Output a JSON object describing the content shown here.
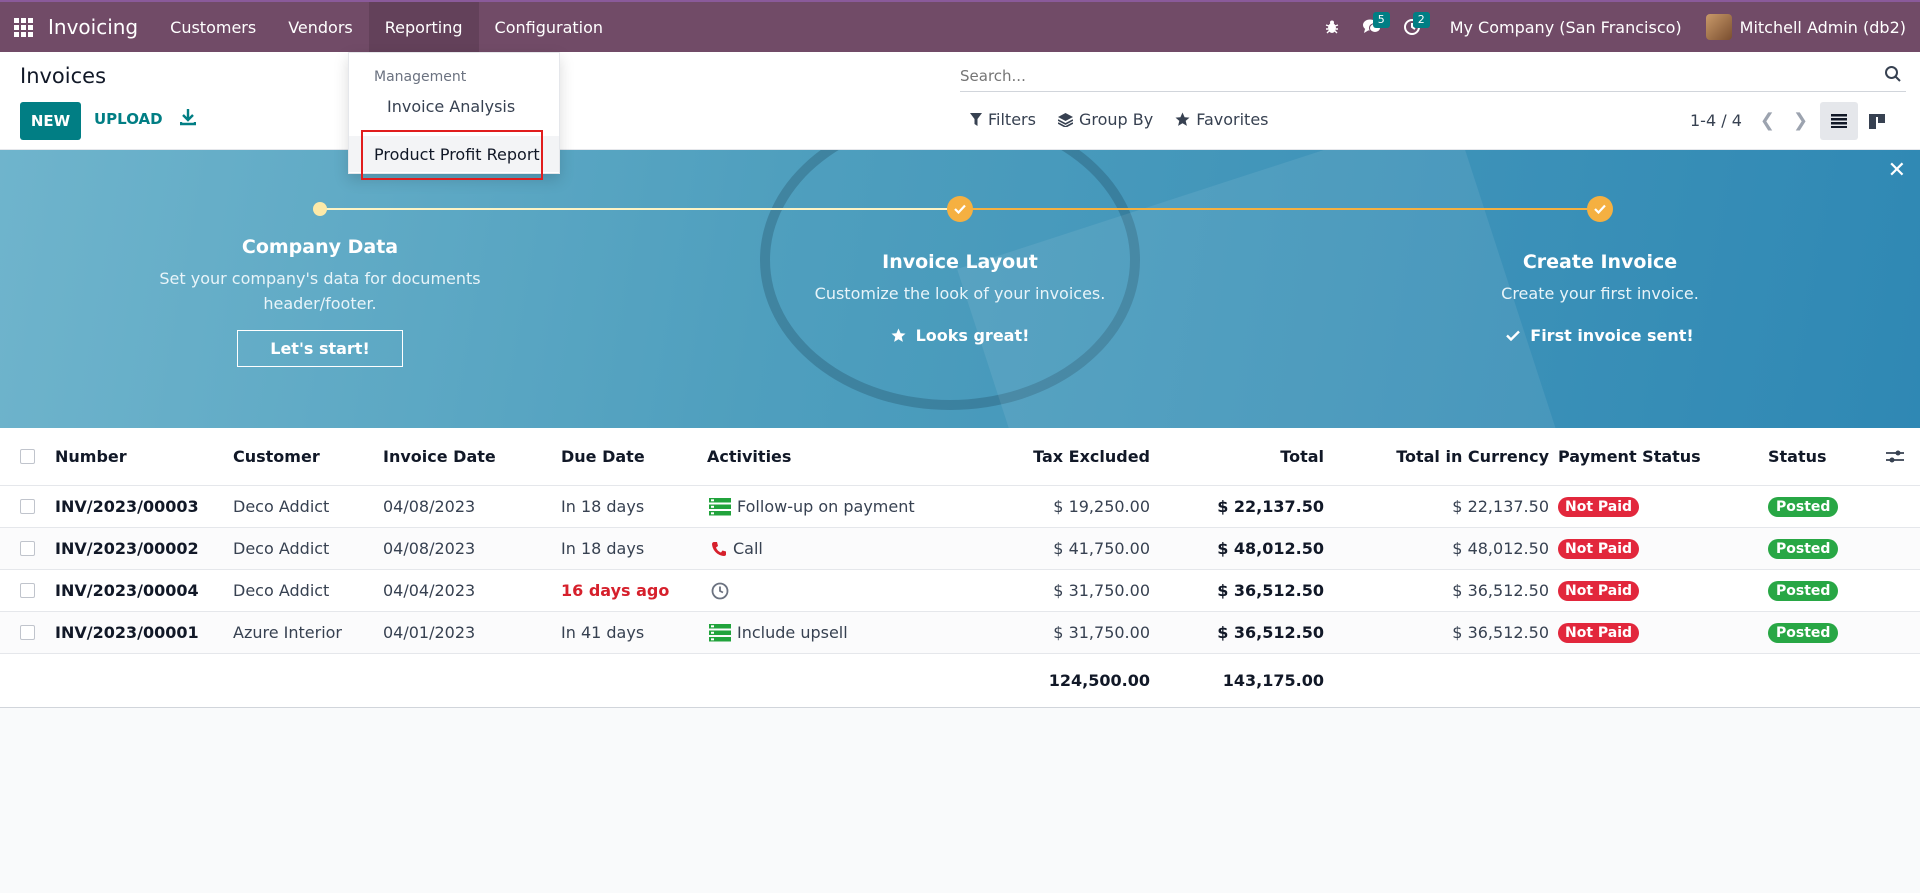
{
  "navbar": {
    "app_name": "Invoicing",
    "menu": [
      "Customers",
      "Vendors",
      "Reporting",
      "Configuration"
    ],
    "messages_count": "5",
    "activities_count": "2",
    "company": "My Company (San Francisco)",
    "user": "Mitchell Admin (db2)"
  },
  "control": {
    "title": "Invoices",
    "new_label": "NEW",
    "upload_label": "UPLOAD",
    "search_placeholder": "Search...",
    "filters_label": "Filters",
    "groupby_label": "Group By",
    "favorites_label": "Favorites",
    "pager": "1-4 / 4"
  },
  "dropdown": {
    "header": "Management",
    "item1": "Invoice Analysis",
    "item2": "Product Profit Report"
  },
  "banner": {
    "steps": [
      {
        "title": "Company Data",
        "desc1": "Set your company's data for documents",
        "desc2": "header/footer.",
        "button": "Let's start!"
      },
      {
        "title": "Invoice Layout",
        "desc": "Customize the look of your invoices.",
        "done": "Looks great!"
      },
      {
        "title": "Create Invoice",
        "desc": "Create your first invoice.",
        "done": "First invoice sent!"
      }
    ]
  },
  "table": {
    "headers": {
      "number": "Number",
      "customer": "Customer",
      "invoice_date": "Invoice Date",
      "due_date": "Due Date",
      "activities": "Activities",
      "tax_excluded": "Tax Excluded",
      "total": "Total",
      "total_currency": "Total in Currency",
      "payment_status": "Payment Status",
      "status": "Status"
    },
    "rows": [
      {
        "number": "INV/2023/00003",
        "customer": "Deco Addict",
        "invoice_date": "04/08/2023",
        "due_date": "In 18 days",
        "activity": "Follow-up on payment",
        "tax_excluded": "$ 19,250.00",
        "total": "$ 22,137.50",
        "total_currency": "$ 22,137.50",
        "payment": "Not Paid",
        "status": "Posted"
      },
      {
        "number": "INV/2023/00002",
        "customer": "Deco Addict",
        "invoice_date": "04/08/2023",
        "due_date": "In 18 days",
        "activity": "Call",
        "tax_excluded": "$ 41,750.00",
        "total": "$ 48,012.50",
        "total_currency": "$ 48,012.50",
        "payment": "Not Paid",
        "status": "Posted"
      },
      {
        "number": "INV/2023/00004",
        "customer": "Deco Addict",
        "invoice_date": "04/04/2023",
        "due_date": "16 days ago",
        "activity": "",
        "tax_excluded": "$ 31,750.00",
        "total": "$ 36,512.50",
        "total_currency": "$ 36,512.50",
        "payment": "Not Paid",
        "status": "Posted"
      },
      {
        "number": "INV/2023/00001",
        "customer": "Azure Interior",
        "invoice_date": "04/01/2023",
        "due_date": "In 41 days",
        "activity": "Include upsell",
        "tax_excluded": "$ 31,750.00",
        "total": "$ 36,512.50",
        "total_currency": "$ 36,512.50",
        "payment": "Not Paid",
        "status": "Posted"
      }
    ],
    "totals": {
      "tax_excluded": "124,500.00",
      "total": "143,175.00"
    }
  },
  "colors": {
    "brand": "#714b67",
    "accent": "#017e84",
    "not_paid": "#e2273c",
    "posted": "#28a745"
  }
}
